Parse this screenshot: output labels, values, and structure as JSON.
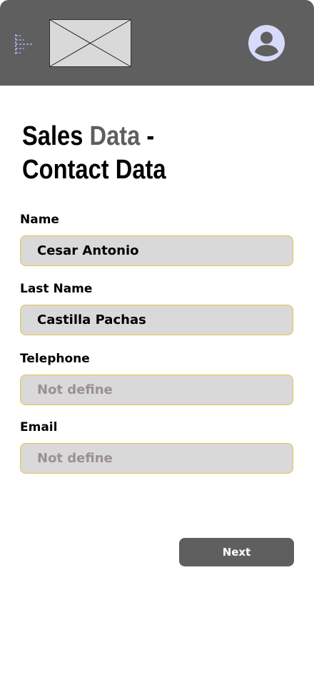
{
  "header": {
    "menu_icon": "menu-icon",
    "logo_icon": "image-placeholder-icon",
    "avatar_icon": "user-avatar-icon",
    "colors": {
      "background": "#5f5f5f",
      "avatar": "#d6dbfb"
    }
  },
  "title": {
    "part1": "Sales ",
    "part2": "Data",
    "part3": " -",
    "line2": "Contact Data"
  },
  "form": {
    "name_label": "Name",
    "name_value": "Cesar Antonio",
    "lastname_label": "Last Name",
    "lastname_value": "Castilla Pachas",
    "telephone_label": "Telephone",
    "telephone_placeholder": "Not define",
    "email_label": "Email",
    "email_placeholder": "Not define"
  },
  "actions": {
    "next_label": "Next"
  }
}
